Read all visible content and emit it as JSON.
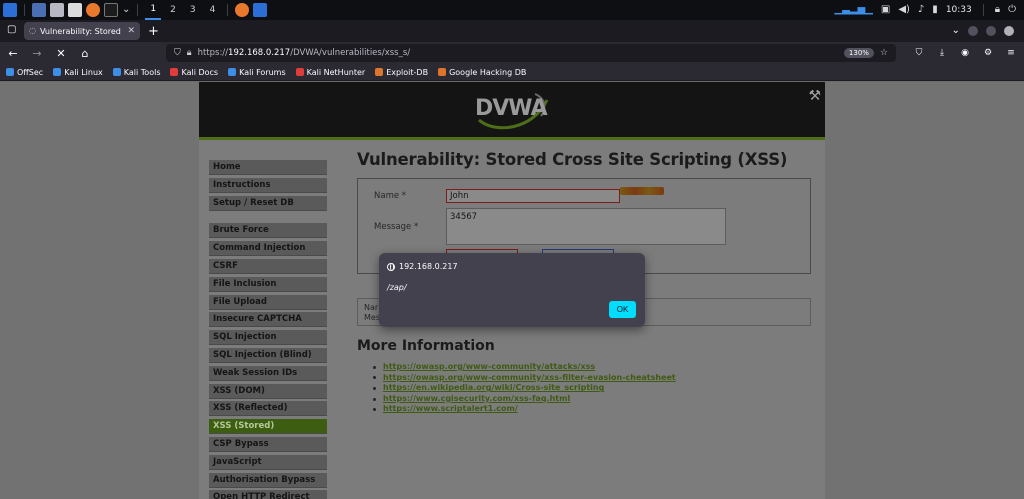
{
  "taskbar": {
    "workspaces": [
      "1",
      "2",
      "3",
      "4"
    ],
    "clock": "10:33"
  },
  "browser": {
    "tab_title": "Vulnerability: Stored Cross",
    "url_scheme": "https://",
    "url_host": "192.168.0.217",
    "url_path": "/DVWA/vulnerabilities/xss_s/",
    "zoom": "130%",
    "bookmarks": [
      {
        "label": "OffSec",
        "color": "#3d8ee8"
      },
      {
        "label": "Kali Linux",
        "color": "#3d8ee8"
      },
      {
        "label": "Kali Tools",
        "color": "#3d8ee8"
      },
      {
        "label": "Kali Docs",
        "color": "#e23b3b"
      },
      {
        "label": "Kali Forums",
        "color": "#3d8ee8"
      },
      {
        "label": "Kali NetHunter",
        "color": "#e23b3b"
      },
      {
        "label": "Exploit-DB",
        "color": "#e0742b"
      },
      {
        "label": "Google Hacking DB",
        "color": "#e0742b"
      }
    ]
  },
  "dvwa": {
    "logo_text": "DVWA",
    "menu": [
      {
        "label": "Home"
      },
      {
        "label": "Instructions"
      },
      {
        "label": "Setup / Reset DB"
      },
      {
        "label": "Brute Force"
      },
      {
        "label": "Command Injection"
      },
      {
        "label": "CSRF"
      },
      {
        "label": "File Inclusion"
      },
      {
        "label": "File Upload"
      },
      {
        "label": "Insecure CAPTCHA"
      },
      {
        "label": "SQL Injection"
      },
      {
        "label": "SQL Injection (Blind)"
      },
      {
        "label": "Weak Session IDs"
      },
      {
        "label": "XSS (DOM)"
      },
      {
        "label": "XSS (Reflected)"
      },
      {
        "label": "XSS (Stored)"
      },
      {
        "label": "CSP Bypass"
      },
      {
        "label": "JavaScript"
      },
      {
        "label": "Authorisation Bypass"
      },
      {
        "label": "Open HTTP Redirect"
      }
    ],
    "selected_menu": "XSS (Stored)",
    "page_title": "Vulnerability: Stored Cross Site Scripting (XSS)",
    "form": {
      "name_label": "Name *",
      "name_value": "John",
      "message_label": "Message *",
      "message_value": "34567"
    },
    "guestbook": {
      "name_prefix": "Nar",
      "message_prefix": "Mes"
    },
    "more_info_title": "More Information",
    "links": [
      "https://owasp.org/www-community/attacks/xss",
      "https://owasp.org/www-community/xss-filter-evasion-cheatsheet",
      "https://en.wikipedia.org/wiki/Cross-site_scripting",
      "https://www.cgisecurity.com/xss-faq.html",
      "https://www.scriptalert1.com/"
    ]
  },
  "dialog": {
    "origin": "192.168.0.217",
    "message": "/zap/",
    "ok_label": "OK",
    "ok_color": "#00ddff"
  }
}
